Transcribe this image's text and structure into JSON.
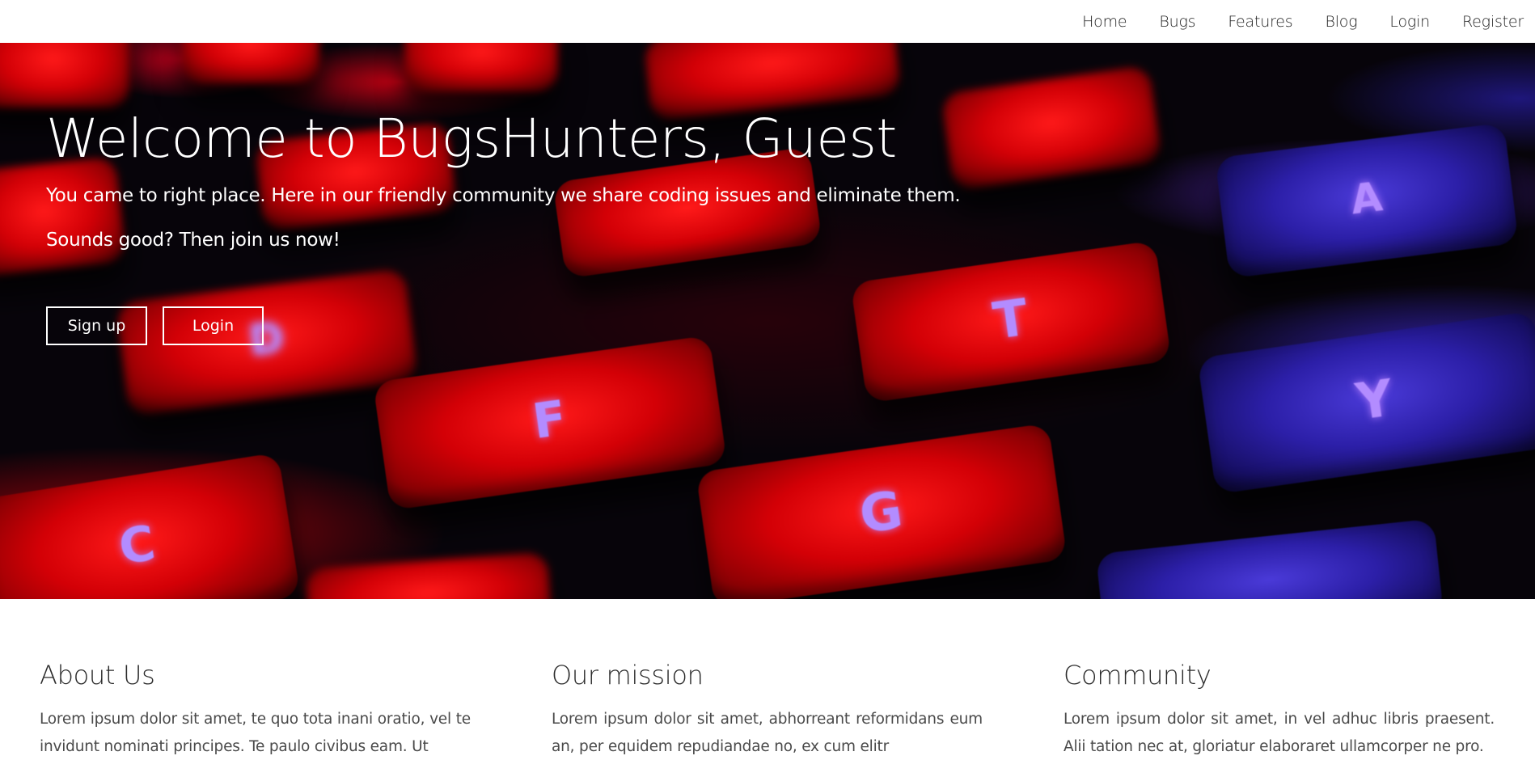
{
  "nav": {
    "items": [
      {
        "label": "Home"
      },
      {
        "label": "Bugs"
      },
      {
        "label": "Features"
      },
      {
        "label": "Blog"
      },
      {
        "label": "Login"
      },
      {
        "label": "Register"
      }
    ]
  },
  "hero": {
    "title": "Welcome to BugsHunters, Guest",
    "subtitle": "You came to right place. Here in our friendly community we share coding issues and eliminate them.",
    "subtitle2": "Sounds good? Then join us now!",
    "signup_label": "Sign up",
    "login_label": "Login",
    "background_keys": [
      "D",
      "F",
      "G",
      "T",
      "Y",
      "C",
      "A"
    ]
  },
  "sections": [
    {
      "title": "About Us",
      "text": "Lorem ipsum dolor sit amet, te quo tota inani oratio, vel te invidunt nominati principes. Te paulo civibus eam. Ut"
    },
    {
      "title": "Our mission",
      "text": "Lorem ipsum dolor sit amet, abhorreant reformidans eum an, per equidem repudiandae no, ex cum elitr"
    },
    {
      "title": "Community",
      "text": "Lorem ipsum dolor sit amet, in vel adhuc libris praesent. Alii tation nec at, gloriatur elaboraret ullamcorper ne pro."
    }
  ],
  "colors": {
    "hero_overlay_text": "#ffffff",
    "key_red": "#d30006",
    "key_blue": "#2c1fa8",
    "body_text": "#4a4a4a"
  }
}
